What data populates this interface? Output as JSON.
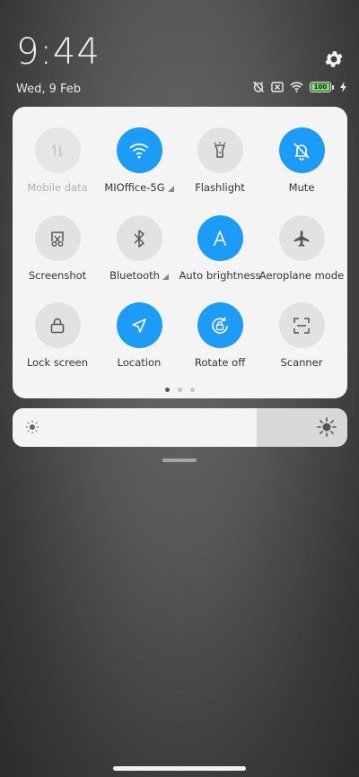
{
  "status": {
    "time": "9:44",
    "date": "Wed, 9 Feb",
    "battery_level": "100"
  },
  "tiles": [
    {
      "label": "Mobile data",
      "icon": "mobile-data-icon",
      "state": "disabled"
    },
    {
      "label": "MIOffice-5G",
      "icon": "wifi-icon",
      "state": "active",
      "has_more": true
    },
    {
      "label": "Flashlight",
      "icon": "flashlight-icon",
      "state": "off"
    },
    {
      "label": "Mute",
      "icon": "bell-muted-icon",
      "state": "active"
    },
    {
      "label": "Screenshot",
      "icon": "screenshot-scissors-icon",
      "state": "off"
    },
    {
      "label": "Bluetooth",
      "icon": "bluetooth-icon",
      "state": "off",
      "has_more": true
    },
    {
      "label": "Auto brightness",
      "icon": "auto-brightness-icon",
      "state": "active"
    },
    {
      "label": "Aeroplane mode",
      "icon": "airplane-icon",
      "state": "off"
    },
    {
      "label": "Lock screen",
      "icon": "lock-icon",
      "state": "off"
    },
    {
      "label": "Location",
      "icon": "location-arrow-icon",
      "state": "active"
    },
    {
      "label": "Rotate off",
      "icon": "rotate-lock-icon",
      "state": "active"
    },
    {
      "label": "Scanner",
      "icon": "scanner-icon",
      "state": "off"
    }
  ],
  "pager": {
    "pages": 3,
    "current": 1
  },
  "brightness": {
    "level": 0.73
  },
  "colors": {
    "accent": "#1c9cf6",
    "panel": "#f4f4f4",
    "tile_off": "#e2e2e2"
  }
}
